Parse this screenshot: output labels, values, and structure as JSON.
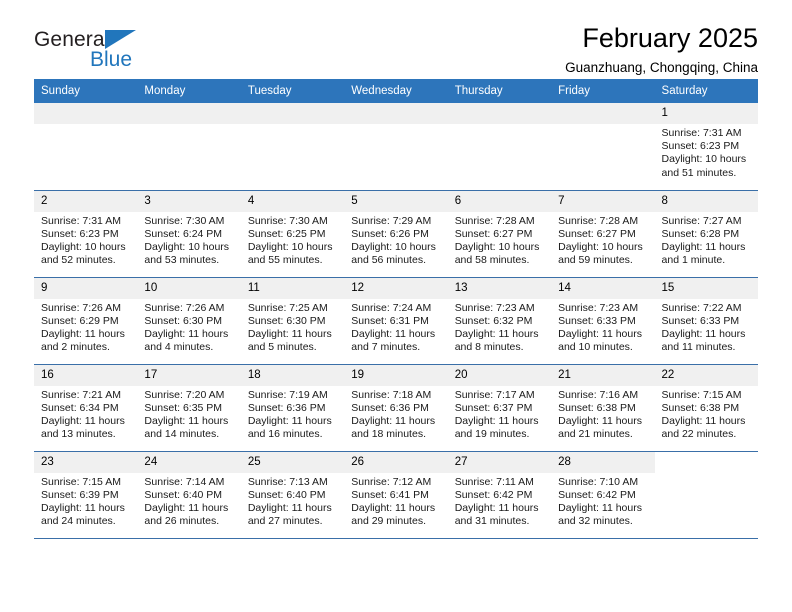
{
  "brand": {
    "name_top": "General",
    "name_bottom": "Blue",
    "triangle_icon": "triangle-icon",
    "color_blue": "#2176bc",
    "color_dark": "#231f20"
  },
  "header": {
    "title": "February 2025",
    "subtitle": "Guanzhuang, Chongqing, China"
  },
  "theme": {
    "header_bar": "#2d75bb",
    "date_band": "#f0f0f0",
    "row_rule": "#3a6fa8"
  },
  "weekdays": [
    "Sunday",
    "Monday",
    "Tuesday",
    "Wednesday",
    "Thursday",
    "Friday",
    "Saturday"
  ],
  "labels": {
    "sunrise": "Sunrise:",
    "sunset": "Sunset:",
    "daylight": "Daylight:"
  },
  "weeks": [
    [
      {
        "blank": true
      },
      {
        "blank": true
      },
      {
        "blank": true
      },
      {
        "blank": true
      },
      {
        "blank": true
      },
      {
        "blank": true
      },
      {
        "day": "1",
        "sunrise": "Sunrise: 7:31 AM",
        "sunset": "Sunset: 6:23 PM",
        "daylight1": "Daylight: 10 hours",
        "daylight2": "and 51 minutes."
      }
    ],
    [
      {
        "day": "2",
        "sunrise": "Sunrise: 7:31 AM",
        "sunset": "Sunset: 6:23 PM",
        "daylight1": "Daylight: 10 hours",
        "daylight2": "and 52 minutes."
      },
      {
        "day": "3",
        "sunrise": "Sunrise: 7:30 AM",
        "sunset": "Sunset: 6:24 PM",
        "daylight1": "Daylight: 10 hours",
        "daylight2": "and 53 minutes."
      },
      {
        "day": "4",
        "sunrise": "Sunrise: 7:30 AM",
        "sunset": "Sunset: 6:25 PM",
        "daylight1": "Daylight: 10 hours",
        "daylight2": "and 55 minutes."
      },
      {
        "day": "5",
        "sunrise": "Sunrise: 7:29 AM",
        "sunset": "Sunset: 6:26 PM",
        "daylight1": "Daylight: 10 hours",
        "daylight2": "and 56 minutes."
      },
      {
        "day": "6",
        "sunrise": "Sunrise: 7:28 AM",
        "sunset": "Sunset: 6:27 PM",
        "daylight1": "Daylight: 10 hours",
        "daylight2": "and 58 minutes."
      },
      {
        "day": "7",
        "sunrise": "Sunrise: 7:28 AM",
        "sunset": "Sunset: 6:27 PM",
        "daylight1": "Daylight: 10 hours",
        "daylight2": "and 59 minutes."
      },
      {
        "day": "8",
        "sunrise": "Sunrise: 7:27 AM",
        "sunset": "Sunset: 6:28 PM",
        "daylight1": "Daylight: 11 hours",
        "daylight2": "and 1 minute."
      }
    ],
    [
      {
        "day": "9",
        "sunrise": "Sunrise: 7:26 AM",
        "sunset": "Sunset: 6:29 PM",
        "daylight1": "Daylight: 11 hours",
        "daylight2": "and 2 minutes."
      },
      {
        "day": "10",
        "sunrise": "Sunrise: 7:26 AM",
        "sunset": "Sunset: 6:30 PM",
        "daylight1": "Daylight: 11 hours",
        "daylight2": "and 4 minutes."
      },
      {
        "day": "11",
        "sunrise": "Sunrise: 7:25 AM",
        "sunset": "Sunset: 6:30 PM",
        "daylight1": "Daylight: 11 hours",
        "daylight2": "and 5 minutes."
      },
      {
        "day": "12",
        "sunrise": "Sunrise: 7:24 AM",
        "sunset": "Sunset: 6:31 PM",
        "daylight1": "Daylight: 11 hours",
        "daylight2": "and 7 minutes."
      },
      {
        "day": "13",
        "sunrise": "Sunrise: 7:23 AM",
        "sunset": "Sunset: 6:32 PM",
        "daylight1": "Daylight: 11 hours",
        "daylight2": "and 8 minutes."
      },
      {
        "day": "14",
        "sunrise": "Sunrise: 7:23 AM",
        "sunset": "Sunset: 6:33 PM",
        "daylight1": "Daylight: 11 hours",
        "daylight2": "and 10 minutes."
      },
      {
        "day": "15",
        "sunrise": "Sunrise: 7:22 AM",
        "sunset": "Sunset: 6:33 PM",
        "daylight1": "Daylight: 11 hours",
        "daylight2": "and 11 minutes."
      }
    ],
    [
      {
        "day": "16",
        "sunrise": "Sunrise: 7:21 AM",
        "sunset": "Sunset: 6:34 PM",
        "daylight1": "Daylight: 11 hours",
        "daylight2": "and 13 minutes."
      },
      {
        "day": "17",
        "sunrise": "Sunrise: 7:20 AM",
        "sunset": "Sunset: 6:35 PM",
        "daylight1": "Daylight: 11 hours",
        "daylight2": "and 14 minutes."
      },
      {
        "day": "18",
        "sunrise": "Sunrise: 7:19 AM",
        "sunset": "Sunset: 6:36 PM",
        "daylight1": "Daylight: 11 hours",
        "daylight2": "and 16 minutes."
      },
      {
        "day": "19",
        "sunrise": "Sunrise: 7:18 AM",
        "sunset": "Sunset: 6:36 PM",
        "daylight1": "Daylight: 11 hours",
        "daylight2": "and 18 minutes."
      },
      {
        "day": "20",
        "sunrise": "Sunrise: 7:17 AM",
        "sunset": "Sunset: 6:37 PM",
        "daylight1": "Daylight: 11 hours",
        "daylight2": "and 19 minutes."
      },
      {
        "day": "21",
        "sunrise": "Sunrise: 7:16 AM",
        "sunset": "Sunset: 6:38 PM",
        "daylight1": "Daylight: 11 hours",
        "daylight2": "and 21 minutes."
      },
      {
        "day": "22",
        "sunrise": "Sunrise: 7:15 AM",
        "sunset": "Sunset: 6:38 PM",
        "daylight1": "Daylight: 11 hours",
        "daylight2": "and 22 minutes."
      }
    ],
    [
      {
        "day": "23",
        "sunrise": "Sunrise: 7:15 AM",
        "sunset": "Sunset: 6:39 PM",
        "daylight1": "Daylight: 11 hours",
        "daylight2": "and 24 minutes."
      },
      {
        "day": "24",
        "sunrise": "Sunrise: 7:14 AM",
        "sunset": "Sunset: 6:40 PM",
        "daylight1": "Daylight: 11 hours",
        "daylight2": "and 26 minutes."
      },
      {
        "day": "25",
        "sunrise": "Sunrise: 7:13 AM",
        "sunset": "Sunset: 6:40 PM",
        "daylight1": "Daylight: 11 hours",
        "daylight2": "and 27 minutes."
      },
      {
        "day": "26",
        "sunrise": "Sunrise: 7:12 AM",
        "sunset": "Sunset: 6:41 PM",
        "daylight1": "Daylight: 11 hours",
        "daylight2": "and 29 minutes."
      },
      {
        "day": "27",
        "sunrise": "Sunrise: 7:11 AM",
        "sunset": "Sunset: 6:42 PM",
        "daylight1": "Daylight: 11 hours",
        "daylight2": "and 31 minutes."
      },
      {
        "day": "28",
        "sunrise": "Sunrise: 7:10 AM",
        "sunset": "Sunset: 6:42 PM",
        "daylight1": "Daylight: 11 hours",
        "daylight2": "and 32 minutes."
      },
      {
        "blank": true
      }
    ]
  ]
}
